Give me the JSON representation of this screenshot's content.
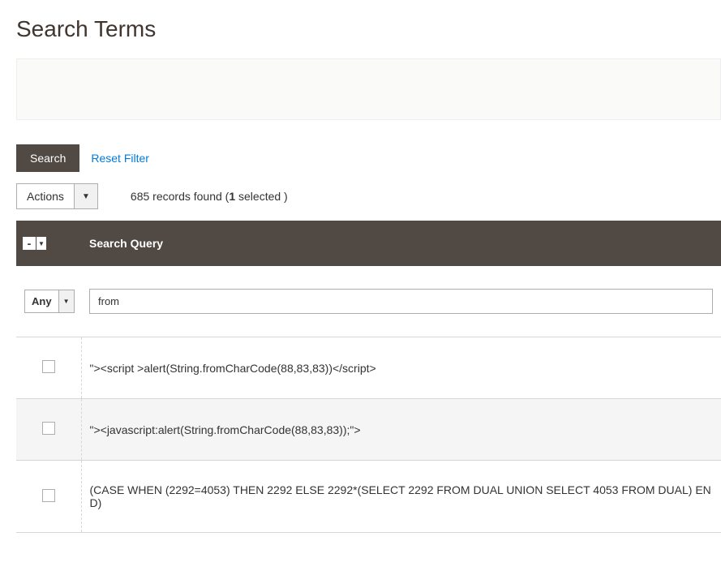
{
  "page": {
    "title": "Search Terms"
  },
  "toolbar": {
    "search_label": "Search",
    "reset_filter_label": "Reset Filter",
    "actions_label": "Actions",
    "records_prefix": "685 records found (",
    "selected_count": "1",
    "records_suffix": " selected )"
  },
  "table": {
    "select_all_symbol": "-",
    "columns": {
      "search_query": "Search Query"
    },
    "filter": {
      "any_label": "Any",
      "search_query_value": "from"
    },
    "rows": [
      {
        "query": "\"><script >alert(String.fromCharCode(88,83,83))</script>"
      },
      {
        "query": "\"><javascript:alert(String.fromCharCode(88,83,83));\">"
      },
      {
        "query": "(CASE WHEN (2292=4053) THEN 2292 ELSE 2292*(SELECT 2292 FROM DUAL UNION SELECT 4053 FROM DUAL) END)"
      }
    ]
  }
}
